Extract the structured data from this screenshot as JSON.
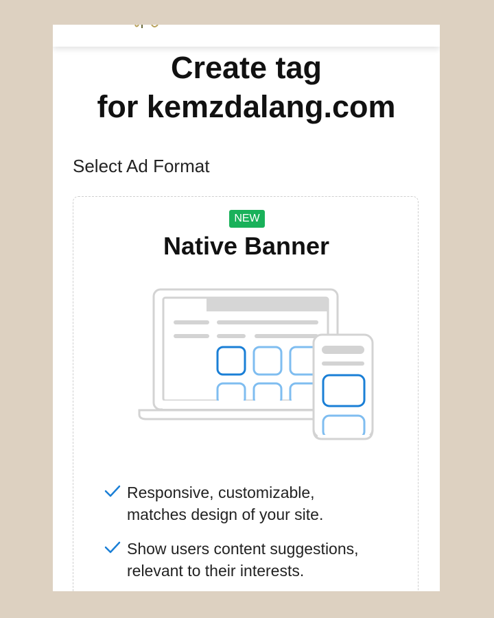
{
  "page": {
    "title_line1": "Create tag",
    "title_line2": "for kemzdalang.com"
  },
  "section": {
    "label": "Select Ad Format"
  },
  "format_card": {
    "badge": "NEW",
    "title": "Native Banner",
    "illustration_icon": "laptop-and-phone-native-banner-icon",
    "features": [
      {
        "line1": "Responsive, customizable,",
        "line2": "matches design of your site."
      },
      {
        "line1": "Show users content suggestions,",
        "line2": "relevant to their interests."
      }
    ]
  },
  "colors": {
    "background": "#ddd1c1",
    "screen": "#ffffff",
    "badge_green": "#19b15a",
    "accent_blue": "#1a7fd6",
    "light_blue": "#7fbdf0",
    "illustration_gray": "#cfcfcf"
  }
}
